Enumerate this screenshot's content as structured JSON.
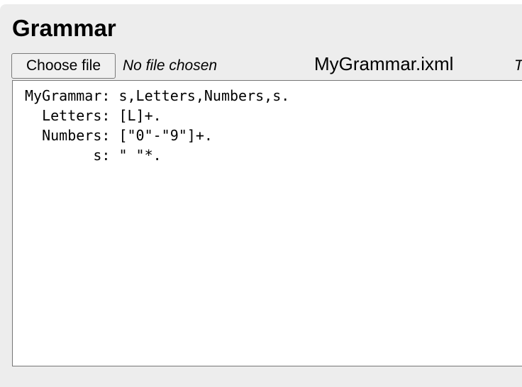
{
  "section": {
    "title": "Grammar"
  },
  "file_input": {
    "button_label": "Choose file",
    "status": "No file chosen"
  },
  "filename": "MyGrammar.ixml",
  "truncated_text": "T",
  "editor": {
    "lines": [
      "MyGrammar: s,Letters,Numbers,s.",
      "  Letters: [L]+.",
      "  Numbers: [\"0\"-\"9\"]+.",
      "        s: \" \"*."
    ]
  }
}
